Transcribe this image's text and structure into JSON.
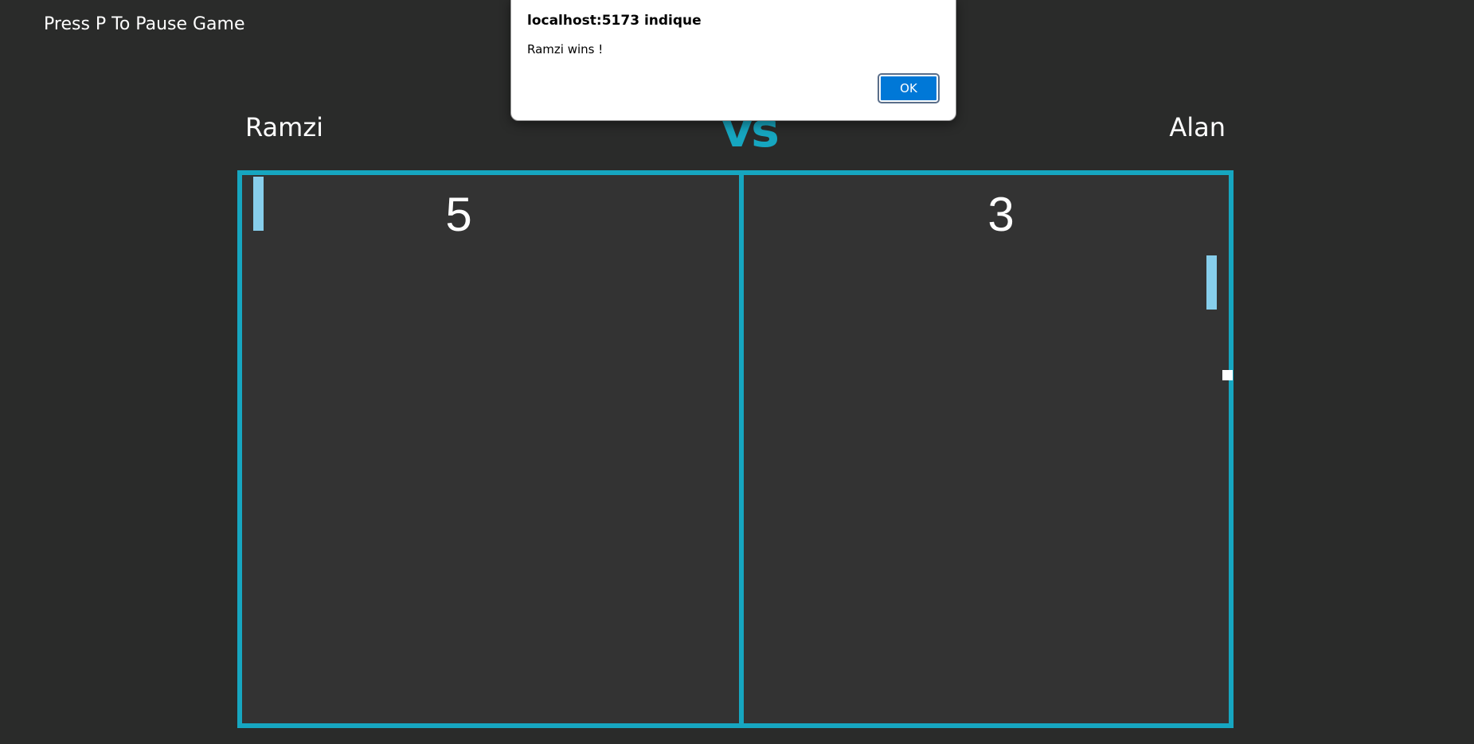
{
  "hint": "Press P To Pause Game",
  "players": {
    "left": "Ramzi",
    "vs": "vs",
    "right": "Alan"
  },
  "scores": {
    "left": "5",
    "right": "3"
  },
  "dialog": {
    "title": "localhost:5173 indique",
    "message": "Ramzi wins !",
    "ok_label": "OK"
  },
  "colors": {
    "background": "#2a2b2a",
    "board": "#333333",
    "accent": "#16a6c0",
    "paddle": "#87ceeb",
    "ball": "#ffffff",
    "dialog_button": "#0078d7"
  }
}
